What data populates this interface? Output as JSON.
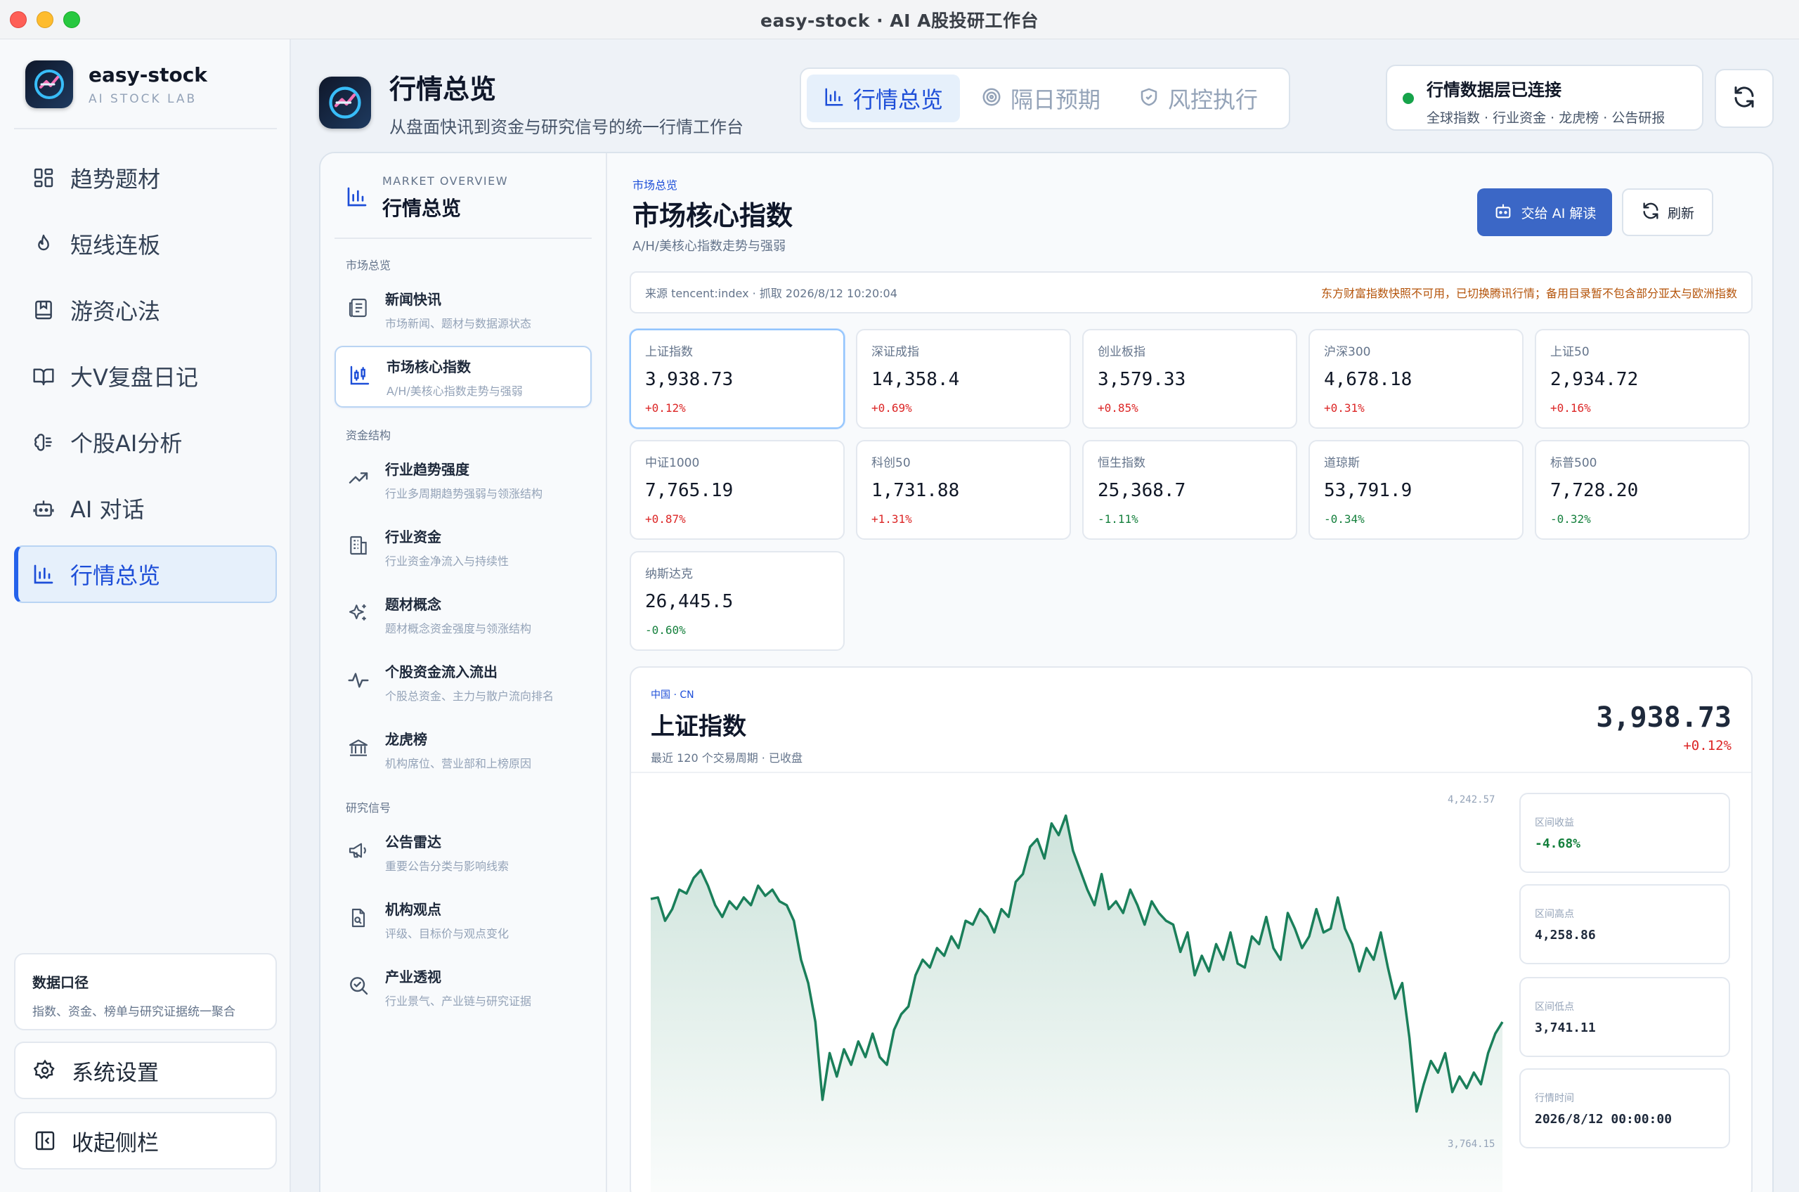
{
  "window": {
    "title": "easy-stock · AI A股投研工作台"
  },
  "brand": {
    "name": "easy-stock",
    "tagline": "AI STOCK LAB"
  },
  "nav": [
    {
      "label": "趋势题材",
      "icon": "grid-icon"
    },
    {
      "label": "短线连板",
      "icon": "flame-icon"
    },
    {
      "label": "游资心法",
      "icon": "bookmark-book-icon"
    },
    {
      "label": "大V复盘日记",
      "icon": "open-book-icon"
    },
    {
      "label": "个股AI分析",
      "icon": "brain-icon"
    },
    {
      "label": "AI 对话",
      "icon": "robot-icon"
    },
    {
      "label": "行情总览",
      "icon": "bar-chart-icon",
      "active": true
    }
  ],
  "data_box": {
    "title": "数据口径",
    "desc": "指数、资金、榜单与研究证据统一聚合"
  },
  "settings_label": "系统设置",
  "collapse_label": "收起侧栏",
  "header": {
    "title": "行情总览",
    "subtitle": "从盘面快讯到资金与研究信号的统一行情工作台",
    "tabs": [
      {
        "label": "行情总览",
        "active": true
      },
      {
        "label": "隔日预期"
      },
      {
        "label": "风控执行"
      }
    ],
    "status": {
      "title": "行情数据层已连接",
      "desc": "全球指数 · 行业资金 · 龙虎榜 · 公告研报"
    }
  },
  "subnav": {
    "en": "MARKET OVERVIEW",
    "cn": "行情总览",
    "groups": [
      {
        "label": "市场总览",
        "items": [
          {
            "title": "新闻快讯",
            "desc": "市场新闻、题材与数据源状态"
          },
          {
            "title": "市场核心指数",
            "desc": "A/H/美核心指数走势与强弱",
            "active": true
          }
        ]
      },
      {
        "label": "资金结构",
        "items": [
          {
            "title": "行业趋势强度",
            "desc": "行业多周期趋势强弱与领涨结构"
          },
          {
            "title": "行业资金",
            "desc": "行业资金净流入与持续性"
          },
          {
            "title": "题材概念",
            "desc": "题材概念资金强度与领涨结构"
          },
          {
            "title": "个股资金流入流出",
            "desc": "个股总资金、主力与散户流向排名"
          },
          {
            "title": "龙虎榜",
            "desc": "机构席位、营业部和上榜原因"
          }
        ]
      },
      {
        "label": "研究信号",
        "items": [
          {
            "title": "公告雷达",
            "desc": "重要公告分类与影响线索"
          },
          {
            "title": "机构观点",
            "desc": "评级、目标价与观点变化"
          },
          {
            "title": "产业透视",
            "desc": "行业景气、产业链与研究证据"
          }
        ]
      }
    ]
  },
  "content": {
    "tag": "市场总览",
    "title": "市场核心指数",
    "subtitle": "A/H/美核心指数走势与强弱",
    "ai_button": "交给 AI 解读",
    "refresh_button": "刷新",
    "source": "来源 tencent:index · 抓取 2026/8/12 10:20:04",
    "notice": "东方财富指数快照不可用，已切换腾讯行情；备用目录暂不包含部分亚太与欧洲指数"
  },
  "indices": [
    {
      "name": "上证指数",
      "value": "3,938.73",
      "change": "+0.12%",
      "dir": "up",
      "selected": true
    },
    {
      "name": "深证成指",
      "value": "14,358.4",
      "change": "+0.69%",
      "dir": "up"
    },
    {
      "name": "创业板指",
      "value": "3,579.33",
      "change": "+0.85%",
      "dir": "up"
    },
    {
      "name": "沪深300",
      "value": "4,678.18",
      "change": "+0.31%",
      "dir": "up"
    },
    {
      "name": "上证50",
      "value": "2,934.72",
      "change": "+0.16%",
      "dir": "up"
    },
    {
      "name": "中证1000",
      "value": "7,765.19",
      "change": "+0.87%",
      "dir": "up"
    },
    {
      "name": "科创50",
      "value": "1,731.88",
      "change": "+1.31%",
      "dir": "up"
    },
    {
      "name": "恒生指数",
      "value": "25,368.7",
      "change": "-1.11%",
      "dir": "down"
    },
    {
      "name": "道琼斯",
      "value": "53,791.9",
      "change": "-0.34%",
      "dir": "down"
    },
    {
      "name": "标普500",
      "value": "7,728.20",
      "change": "-0.32%",
      "dir": "down"
    },
    {
      "name": "纳斯达克",
      "value": "26,445.5",
      "change": "-0.60%",
      "dir": "down"
    }
  ],
  "detail": {
    "tag": "中国 · CN",
    "name": "上证指数",
    "desc": "最近 120 个交易周期 · 已收盘",
    "value": "3,938.73",
    "change": "+0.12%",
    "stats": [
      {
        "label": "区间收益",
        "value": "-4.68%",
        "dir": "down"
      },
      {
        "label": "区间高点",
        "value": "4,258.86"
      },
      {
        "label": "区间低点",
        "value": "3,741.11"
      },
      {
        "label": "行情时间",
        "value": "2026/8/12 00:00:00"
      }
    ]
  },
  "chart_data": {
    "type": "area",
    "title": "",
    "xlabel": "",
    "ylabel": "",
    "y_max_label": "4,242.57",
    "y_min_label": "3,764.15",
    "ylim": [
      3764.15,
      4242.57
    ],
    "line_color": "#1a7f5a",
    "values": [
      4108,
      4110,
      4080,
      4095,
      4120,
      4115,
      4135,
      4145,
      4125,
      4100,
      4085,
      4105,
      4095,
      4110,
      4100,
      4125,
      4112,
      4120,
      4105,
      4100,
      4080,
      4030,
      4000,
      3950,
      3850,
      3910,
      3880,
      3915,
      3895,
      3925,
      3905,
      3935,
      3905,
      3895,
      3940,
      3960,
      3970,
      4010,
      4030,
      4020,
      4045,
      4035,
      4060,
      4045,
      4080,
      4075,
      4095,
      4085,
      4065,
      4095,
      4085,
      4130,
      4140,
      4175,
      4185,
      4160,
      4205,
      4190,
      4215,
      4170,
      4145,
      4120,
      4100,
      4140,
      4095,
      4105,
      4090,
      4120,
      4100,
      4075,
      4105,
      4090,
      4080,
      4075,
      4040,
      4065,
      4010,
      4035,
      4015,
      4050,
      4030,
      4065,
      4025,
      4020,
      4060,
      4050,
      4085,
      4045,
      4030,
      4090,
      4070,
      4045,
      4060,
      4095,
      4065,
      4070,
      4110,
      4070,
      4050,
      4015,
      4045,
      4030,
      4065,
      4020,
      3980,
      4000,
      3930,
      3835,
      3870,
      3900,
      3885,
      3910,
      3860,
      3880,
      3865,
      3885,
      3870,
      3910,
      3935,
      3950
    ]
  }
}
